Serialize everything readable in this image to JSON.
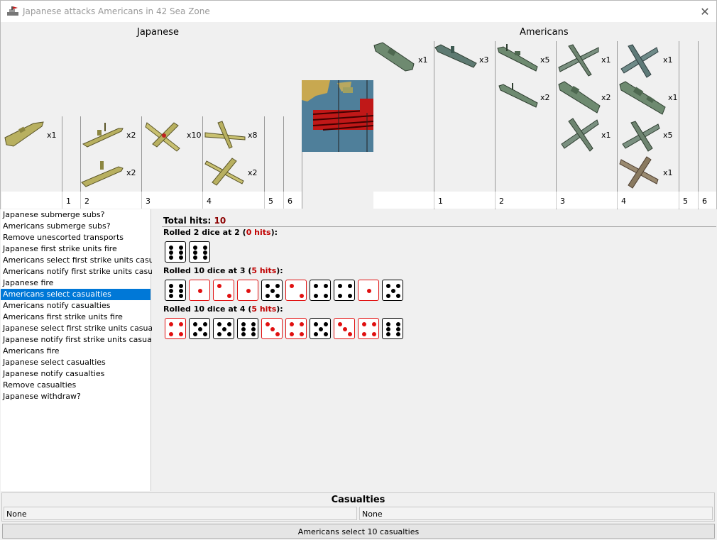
{
  "window": {
    "title": "Japanese attacks Americans in 42 Sea Zone",
    "icon": "battle-flag-icon",
    "close_icon": "close-icon"
  },
  "battle": {
    "attacker_label": "Japanese",
    "defender_label": "Americans",
    "attacker_columns": [
      "1",
      "2",
      "3",
      "4",
      "5",
      "6"
    ],
    "defender_columns": [
      "1",
      "2",
      "3",
      "4",
      "5",
      "6"
    ],
    "attacker_units": [
      {
        "type": "transport",
        "count": "x1"
      },
      {
        "type": "destroyer",
        "count": "x2"
      },
      {
        "type": "submarine",
        "count": "x2"
      },
      {
        "type": "fighter",
        "count": "x10"
      },
      {
        "type": "bomber",
        "count": "x8"
      },
      {
        "type": "tactical-bomber",
        "count": "x2"
      }
    ],
    "defender_units": [
      {
        "type": "transport",
        "count": "x1"
      },
      {
        "type": "submarine",
        "count": "x3"
      },
      {
        "type": "destroyer",
        "count": "x5"
      },
      {
        "type": "destroyer",
        "count": "x2"
      },
      {
        "type": "bomber",
        "count": "x1"
      },
      {
        "type": "cruiser",
        "count": "x2"
      },
      {
        "type": "fighter",
        "count": "x1"
      },
      {
        "type": "fighter",
        "count": "x1"
      },
      {
        "type": "battleship",
        "count": "x1"
      },
      {
        "type": "fighter",
        "count": "x5"
      },
      {
        "type": "fighter",
        "count": "x1"
      }
    ],
    "colors": {
      "japanese": "#b8b060",
      "americans": "#6e8a70",
      "hit": "#e01010"
    }
  },
  "steps": [
    "Japanese submerge subs?",
    "Americans submerge subs?",
    "Remove unescorted transports",
    "Japanese first strike units fire",
    "Americans select first strike units casualties",
    "Americans notify first strike units casualties",
    "Japanese fire",
    "Americans select casualties",
    "Americans notify casualties",
    "Americans first strike units fire",
    "Japanese select first strike units casualties",
    "Japanese notify first strike units casualties",
    "Americans fire",
    "Japanese select casualties",
    "Japanese notify casualties",
    "Remove casualties",
    "Japanese withdraw?"
  ],
  "selected_step": 7,
  "dice": {
    "total_label": "Total hits:",
    "total_value": "10",
    "rolls": [
      {
        "prefix": "Rolled 2 dice at 2 (",
        "hits": "0 hits",
        "suffix": "):",
        "values": [
          6,
          6
        ],
        "hit": [
          false,
          false
        ]
      },
      {
        "prefix": "Rolled 10 dice at 3 (",
        "hits": "5 hits",
        "suffix": "):",
        "values": [
          6,
          1,
          2,
          1,
          5,
          2,
          4,
          4,
          1,
          5
        ],
        "hit": [
          false,
          true,
          true,
          true,
          false,
          true,
          false,
          false,
          true,
          false
        ]
      },
      {
        "prefix": "Rolled 10 dice at 4 (",
        "hits": "5 hits",
        "suffix": "):",
        "values": [
          4,
          5,
          5,
          6,
          3,
          4,
          5,
          3,
          4,
          6
        ],
        "hit": [
          true,
          false,
          false,
          false,
          true,
          true,
          false,
          true,
          true,
          false
        ]
      }
    ]
  },
  "casualties": {
    "title": "Casualties",
    "left": "None",
    "right": "None"
  },
  "status": "Americans select 10 casualties"
}
